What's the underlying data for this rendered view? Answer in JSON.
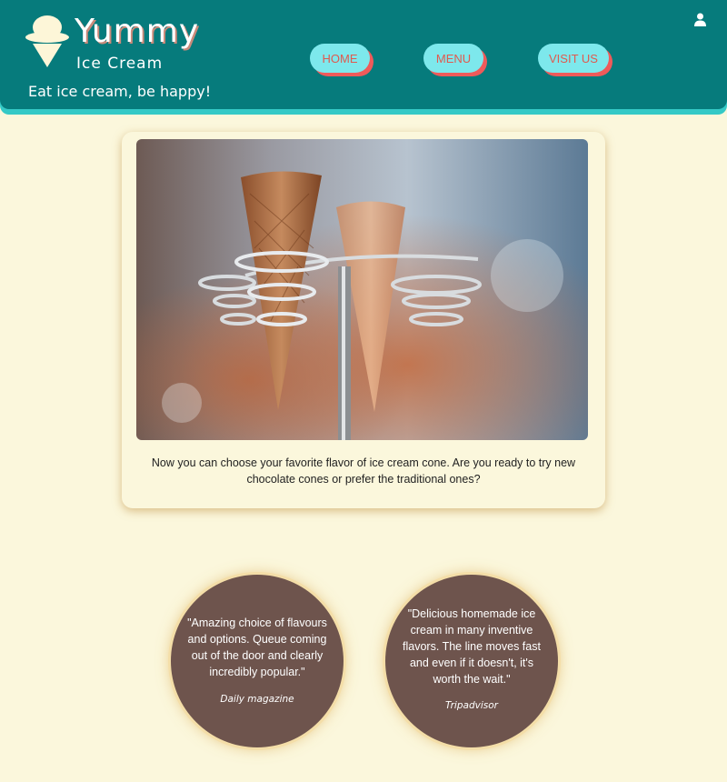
{
  "header": {
    "brand_primary": "Yummy",
    "brand_secondary": "Ice Cream",
    "tagline": "Eat ice cream, be happy!",
    "logo_icon": "ice-cream-cone-icon",
    "user_icon": "user-icon"
  },
  "nav": {
    "home": "HOME",
    "menu": "MENU",
    "visit": "VISIT US"
  },
  "featured": {
    "description": "Now you can choose your favorite flavor of ice cream cone. Are you ready to try new chocolate cones or prefer the traditional ones?"
  },
  "reviews": [
    {
      "quote": "\"Amazing choice of flavours and options. Queue coming out of the door and clearly incredibly popular.\"",
      "source": "Daily magazine"
    },
    {
      "quote": "\"Delicious homemade ice cream in many inventive flavors. The line moves fast and even if it doesn't, it's worth the wait.\"",
      "source": "Tripadvisor"
    }
  ],
  "colors": {
    "header_bg": "#067b7c",
    "header_shadow": "#34c9c6",
    "page_bg": "#fbf7dc",
    "nav_bg": "#7de8ec",
    "nav_text": "#e05a4f",
    "nav_shadow": "#ef5a5a",
    "review_bg": "#6e544d"
  }
}
